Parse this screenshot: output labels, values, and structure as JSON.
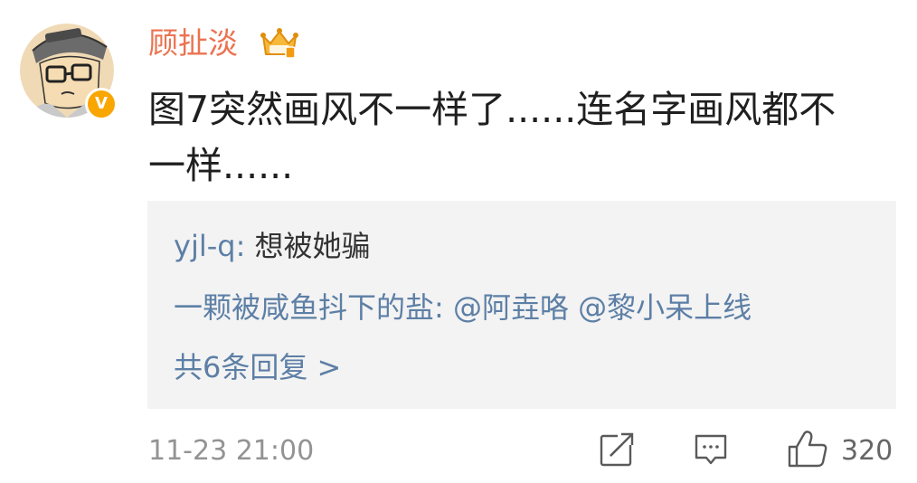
{
  "comment": {
    "username": "顾扯淡",
    "text": "图7突然画风不一样了......连名字画风都不一样......",
    "verified_badge": "V",
    "icons": {
      "avatar": "cartoon-avatar-icon",
      "crown": "crown-badge-icon",
      "verified": "verified-v-icon"
    }
  },
  "replies": {
    "items": [
      {
        "author": "yjl-q",
        "separator": ": ",
        "text": "想被她骗"
      },
      {
        "author": "一颗被咸鱼抖下的盐",
        "separator": ": ",
        "text": "",
        "mentions": [
          "@阿垚咯",
          "@黎小呆上线"
        ]
      }
    ],
    "more_link": "共6条回复 >"
  },
  "footer": {
    "timestamp": "11-23 21:00",
    "like_count": "320",
    "icons": [
      "share-icon",
      "comment-icon",
      "like-icon"
    ]
  },
  "colors": {
    "username": "#eb7350",
    "link": "#5d7fa6",
    "text": "#1f1f1f",
    "muted": "#939393",
    "reply_bg": "#f3f3f3",
    "badge": "#f9a602"
  }
}
